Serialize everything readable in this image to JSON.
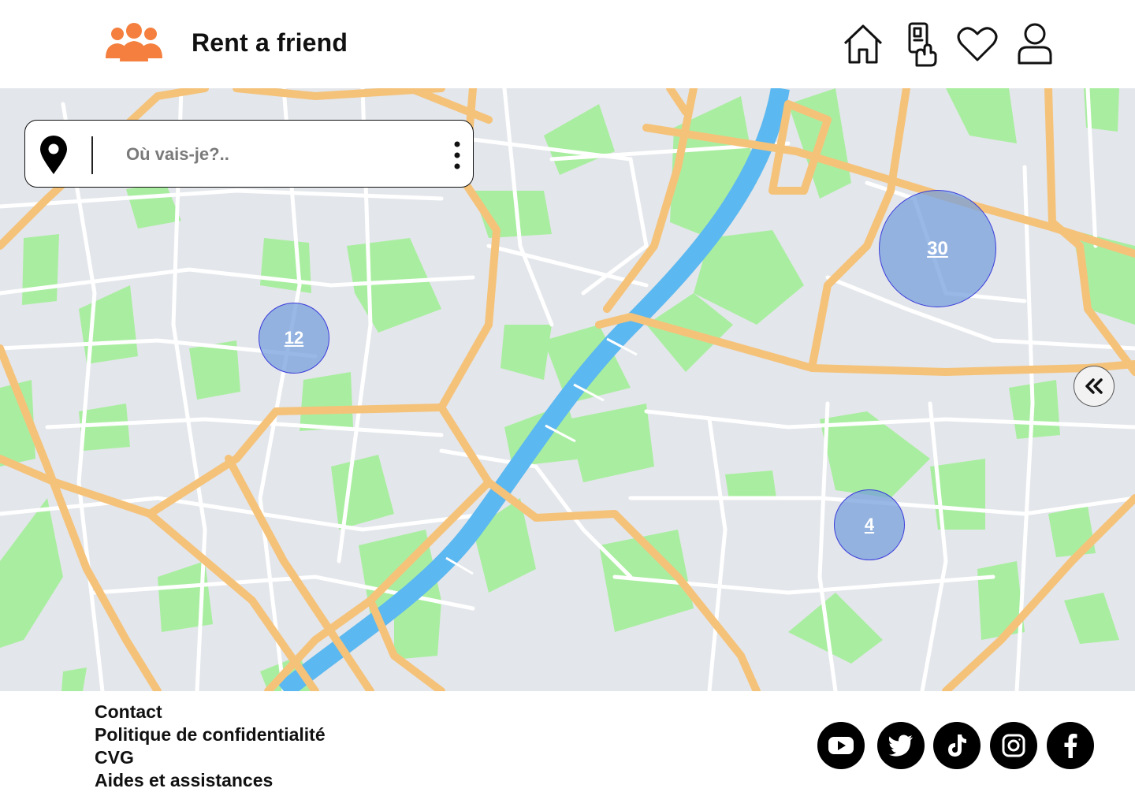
{
  "header": {
    "brand": "Rent a friend",
    "nav": [
      {
        "name": "home-icon"
      },
      {
        "name": "phone-tap-icon"
      },
      {
        "name": "heart-icon"
      },
      {
        "name": "user-icon"
      }
    ]
  },
  "search": {
    "placeholder": "Où vais-je?.."
  },
  "map": {
    "clusters": [
      {
        "count": "12"
      },
      {
        "count": "30"
      },
      {
        "count": "4"
      }
    ]
  },
  "footer": {
    "links": [
      "Contact",
      "Politique de confidentialité",
      "CVG",
      "Aides et assistances"
    ],
    "social": [
      "youtube-icon",
      "twitter-icon",
      "tiktok-icon",
      "instagram-icon",
      "facebook-icon"
    ]
  },
  "colors": {
    "brand_orange": "#F47F3E",
    "park_green": "#A9EEA0",
    "road_orange": "#F5C27A",
    "river_blue": "#5CB8F0",
    "cluster_fill": "#78A0DC"
  }
}
